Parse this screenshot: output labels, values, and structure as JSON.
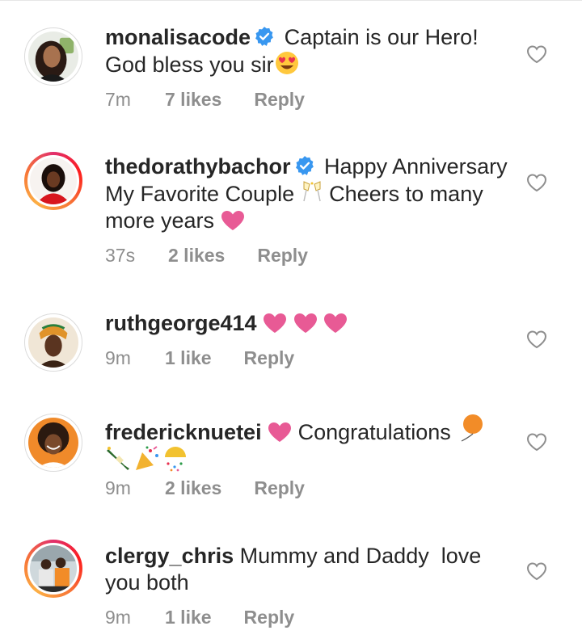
{
  "comments": [
    {
      "username": "monalisacode",
      "verified": true,
      "text": "Captain is our Hero! God bless you sir",
      "emojis": [
        "heart-eyes-emoji"
      ],
      "time": "7m",
      "likes": "7 likes",
      "reply": "Reply",
      "story_ring": false
    },
    {
      "username": "thedorathybachor",
      "verified": true,
      "text_line1": "Happy Anniversary",
      "text_line2": "My Favorite Couple",
      "text_line2b": "Cheers to many",
      "text_line3": "more years",
      "emojis": [
        "champagne-glasses-emoji",
        "pink-heart-emoji"
      ],
      "time": "37s",
      "likes": "2 likes",
      "reply": "Reply",
      "story_ring": true
    },
    {
      "username": "ruthgeorge414",
      "verified": false,
      "emojis": [
        "pink-heart-emoji",
        "pink-heart-emoji",
        "pink-heart-emoji"
      ],
      "time": "9m",
      "likes": "1 like",
      "reply": "Reply",
      "story_ring": false
    },
    {
      "username": "fredericknuetei",
      "verified": false,
      "text": "Congratulations",
      "emojis": [
        "pink-heart-emoji",
        "balloon-emoji",
        "champagne-bottle-emoji",
        "party-popper-emoji",
        "confetti-ball-emoji"
      ],
      "time": "9m",
      "likes": "2 likes",
      "reply": "Reply",
      "story_ring": false
    },
    {
      "username": "clergy_chris",
      "verified": false,
      "text_line1": "Mummy and Daddy  love",
      "text_line2": "you both",
      "time": "9m",
      "likes": "1 like",
      "reply": "Reply",
      "story_ring": true
    }
  ],
  "colors": {
    "text": "#262626",
    "meta": "#8e8e8e",
    "verified": "#3897f0",
    "heart_emoji": "#e85a95"
  }
}
